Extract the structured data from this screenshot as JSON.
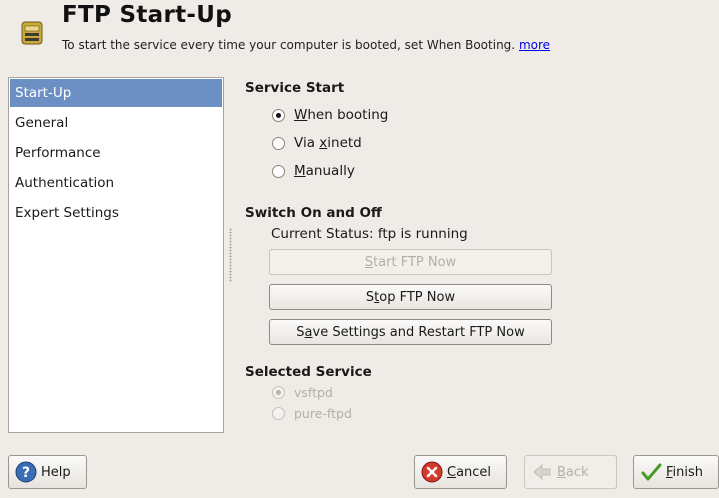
{
  "header": {
    "title": "FTP Start-Up",
    "subtitle": "To start the service every time your computer is booted, set When Booting.",
    "more_link": "more",
    "icon": "ftp-app-icon"
  },
  "sidebar": {
    "items": [
      {
        "label": "Start-Up",
        "selected": true
      },
      {
        "label": "General"
      },
      {
        "label": "Performance"
      },
      {
        "label": "Authentication"
      },
      {
        "label": "Expert Settings"
      }
    ]
  },
  "service_start": {
    "heading": "Service Start",
    "options": [
      {
        "pre": "",
        "mn": "W",
        "post": "hen booting",
        "checked": true
      },
      {
        "pre": "Via ",
        "mn": "x",
        "post": "inetd",
        "checked": false
      },
      {
        "pre": "",
        "mn": "M",
        "post": "anually",
        "checked": false
      }
    ]
  },
  "switch": {
    "heading": "Switch On and Off",
    "status": "Current Status:  ftp is running",
    "start_button": {
      "pre": "",
      "mn": "S",
      "post": "tart FTP Now",
      "enabled": false
    },
    "stop_button": {
      "pre": "S",
      "mn": "t",
      "post": "op FTP Now",
      "enabled": true
    },
    "save_button": {
      "pre": "S",
      "mn": "a",
      "post": "ve Settings and Restart FTP Now",
      "enabled": true
    }
  },
  "selected_service": {
    "heading": "Selected Service",
    "options": [
      {
        "label": "vsftpd",
        "checked": true,
        "enabled": false
      },
      {
        "label": "pure-ftpd",
        "checked": false,
        "enabled": false
      }
    ]
  },
  "footer": {
    "help": "Help",
    "cancel": {
      "mn": "C",
      "post": "ancel"
    },
    "back": {
      "mn": "B",
      "post": "ack",
      "enabled": false
    },
    "finish": {
      "mn": "F",
      "post": "inish"
    }
  }
}
